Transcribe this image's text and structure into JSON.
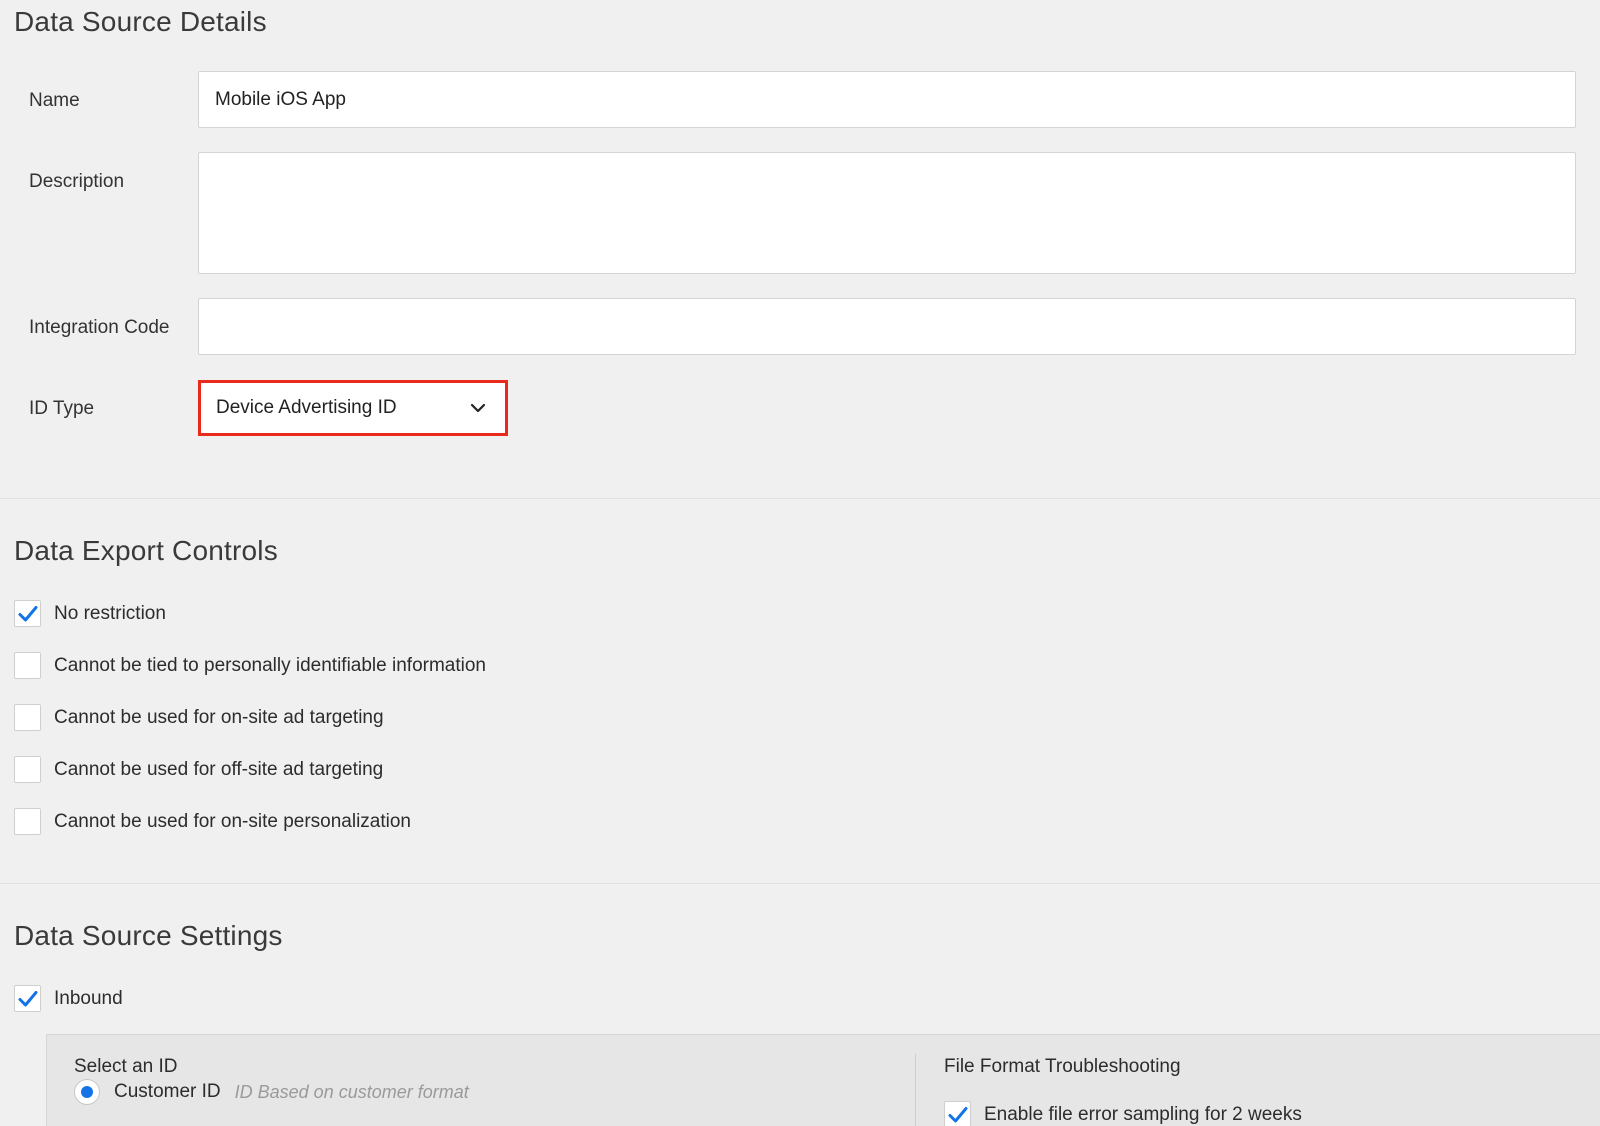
{
  "details": {
    "title": "Data Source Details",
    "name_label": "Name",
    "name_value": "Mobile iOS App",
    "description_label": "Description",
    "description_value": "",
    "integration_label": "Integration Code",
    "integration_value": "",
    "id_type_label": "ID Type",
    "id_type_value": "Device Advertising ID"
  },
  "export": {
    "title": "Data Export Controls",
    "options": [
      {
        "label": "No restriction",
        "checked": true
      },
      {
        "label": "Cannot be tied to personally identifiable information",
        "checked": false
      },
      {
        "label": "Cannot be used for on-site ad targeting",
        "checked": false
      },
      {
        "label": "Cannot be used for off-site ad targeting",
        "checked": false
      },
      {
        "label": "Cannot be used for on-site personalization",
        "checked": false
      }
    ]
  },
  "settings": {
    "title": "Data Source Settings",
    "inbound_label": "Inbound",
    "inbound_checked": true,
    "select_id_heading": "Select an ID",
    "customer_id_label": "Customer ID",
    "customer_id_hint": "ID Based on customer format",
    "troubleshooting_heading": "File Format Troubleshooting",
    "sampling_label": "Enable file error sampling for 2 weeks",
    "sampling_checked": true
  },
  "colors": {
    "accent": "#1473e6",
    "highlight_border": "#e8291c"
  },
  "icons": {
    "check": "checkmark-icon",
    "dropdown": "chevron-down-icon"
  }
}
